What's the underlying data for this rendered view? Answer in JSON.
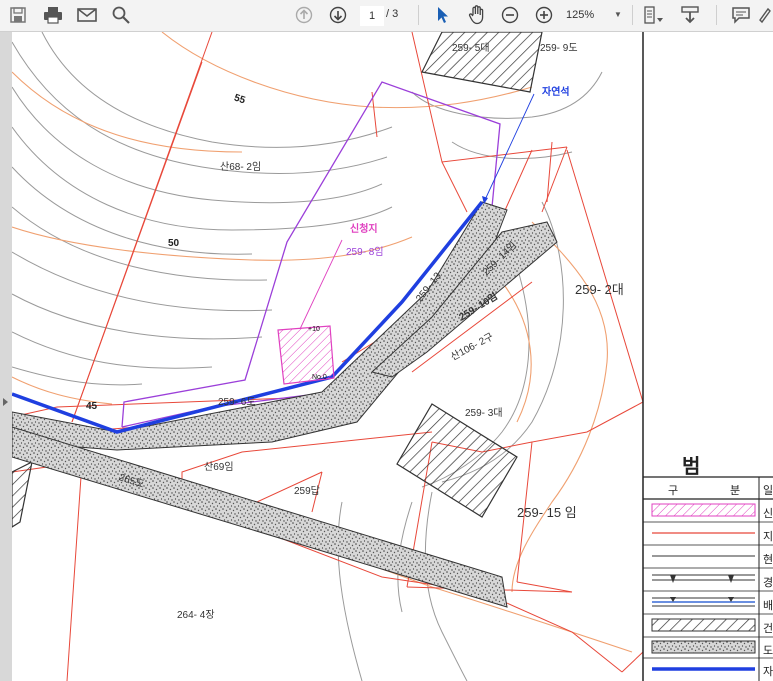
{
  "toolbar": {
    "icons": [
      "save-icon",
      "print-icon",
      "email-icon",
      "search-icon",
      "prev-page-icon",
      "next-page-icon",
      "select-cursor-icon",
      "hand-tool-icon",
      "zoom-out-icon",
      "zoom-in-icon",
      "fit-page-icon",
      "export-icon",
      "comment-icon"
    ],
    "page_current": "1",
    "page_total": "/ 3",
    "zoom": "125%"
  },
  "map": {
    "labels": {
      "lot_259_5": "259- 5대",
      "lot_259_9": "259- 9도",
      "natural_stone": "자연석",
      "contour_55": "55",
      "contour_50": "50",
      "contour_45": "45",
      "lot_s68_2": "산68- 2임",
      "applicant": "신청지",
      "lot_259_8": "259- 8임",
      "lot_259_13": "259- 13",
      "lot_259_14": "259- 14임",
      "lot_259_10": "259- 10임",
      "lot_259_2": "259- 2대",
      "lot_s106_2": "산106- 2구",
      "lot_259_6": "259- 6도",
      "lot_259_3": "259- 3대",
      "lot_s69": "산69임",
      "lot_265": "265도",
      "lot_259": "259답",
      "lot_259_15": "259- 15 임",
      "lot_264_4": "264- 4장",
      "marker_top": "+10",
      "marker_bottom": "No.0"
    }
  },
  "legend": {
    "title": "범",
    "col_left": "구",
    "col_right": "분",
    "col_cut": "일",
    "rows": [
      "신",
      "지",
      "현",
      "경",
      "배",
      "건",
      "도",
      "자"
    ]
  },
  "colors": {
    "parcel_line": "#e8483a",
    "contour_orange": "#f0a070",
    "contour_gray": "#9a9a9a",
    "applicant_purple": "#9b3fd9",
    "road_blue": "#1f3fe0",
    "hatch_magenta": "#e040c0"
  }
}
